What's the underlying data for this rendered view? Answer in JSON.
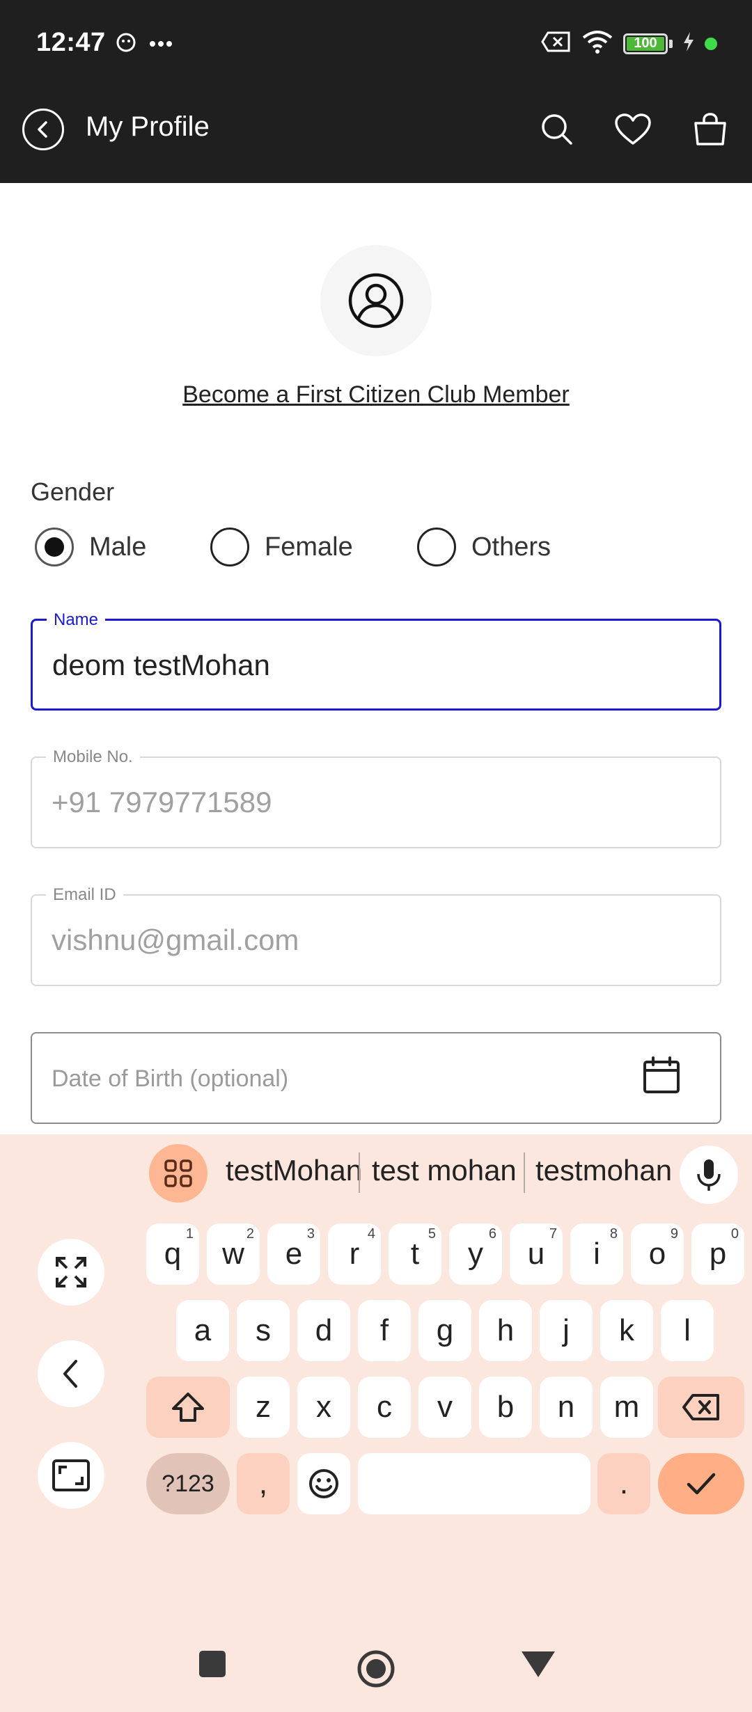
{
  "status_bar": {
    "time": "12:47",
    "battery_level": 100,
    "battery_label": "100"
  },
  "header": {
    "title": "My Profile"
  },
  "profile": {
    "club_link": "Become a First Citizen Club Member"
  },
  "gender": {
    "label": "Gender",
    "options": [
      "Male",
      "Female",
      "Others"
    ],
    "selected": "Male"
  },
  "fields": {
    "name": {
      "label": "Name",
      "value": "deom testMohan"
    },
    "mobile": {
      "label": "Mobile No.",
      "value": "+91 7979771589"
    },
    "email": {
      "label": "Email ID",
      "value": "vishnu@gmail.com"
    },
    "dob": {
      "placeholder": "Date of Birth (optional)"
    }
  },
  "keyboard": {
    "suggestions": [
      "testMohan",
      "test mohan",
      "testmohan"
    ],
    "row1": [
      {
        "k": "q",
        "h": "1"
      },
      {
        "k": "w",
        "h": "2"
      },
      {
        "k": "e",
        "h": "3"
      },
      {
        "k": "r",
        "h": "4"
      },
      {
        "k": "t",
        "h": "5"
      },
      {
        "k": "y",
        "h": "6"
      },
      {
        "k": "u",
        "h": "7"
      },
      {
        "k": "i",
        "h": "8"
      },
      {
        "k": "o",
        "h": "9"
      },
      {
        "k": "p",
        "h": "0"
      }
    ],
    "row2": [
      "a",
      "s",
      "d",
      "f",
      "g",
      "h",
      "j",
      "k",
      "l"
    ],
    "row3": [
      "z",
      "x",
      "c",
      "v",
      "b",
      "n",
      "m"
    ],
    "symbols_label": "?123",
    "comma": ",",
    "period": "."
  },
  "colors": {
    "header_bg": "#1f1f1f",
    "active_border": "#1a1ad6",
    "keyboard_bg": "#fce7df",
    "accent_key": "#ffae85",
    "battery_green": "#4fb83a"
  }
}
